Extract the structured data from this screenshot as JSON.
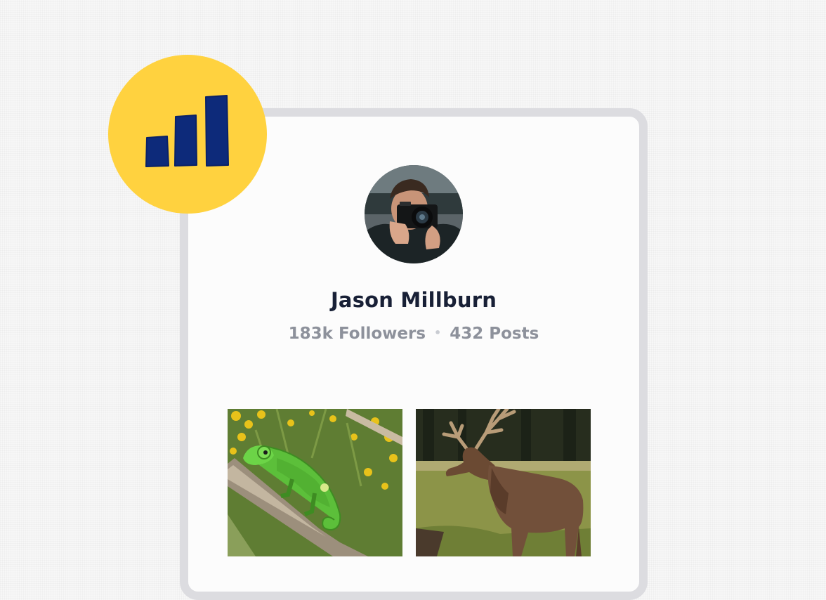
{
  "profile": {
    "name": "Jason Millburn",
    "followers": "183k Followers",
    "separator": "•",
    "posts": "432 Posts"
  },
  "badge": {
    "icon": "bar-chart-icon",
    "background_color": "#ffd23f",
    "icon_color": "#0d2a7a"
  },
  "gallery": {
    "items": [
      {
        "subject": "chameleon-photo"
      },
      {
        "subject": "deer-photo"
      }
    ]
  }
}
